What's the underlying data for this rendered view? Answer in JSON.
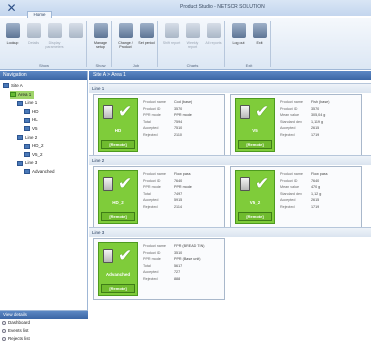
{
  "window": {
    "title": "Product Studio - NETSCR SOLUTION"
  },
  "ribbon": {
    "tab": "Home",
    "groups": [
      {
        "label": "Show",
        "buttons": [
          {
            "label": "Lookup",
            "dim": false
          },
          {
            "label": "Details",
            "dim": true
          },
          {
            "label": "Display parameters",
            "dim": true
          },
          {
            "label": "",
            "dim": true
          }
        ]
      },
      {
        "label": "Show",
        "buttons": [
          {
            "label": "Manage setup",
            "dim": false
          }
        ]
      },
      {
        "label": "Job",
        "buttons": [
          {
            "label": "Change / Product",
            "dim": false
          },
          {
            "label": "Set period",
            "dim": false
          }
        ]
      },
      {
        "label": "Charts",
        "buttons": [
          {
            "label": "Shift report",
            "dim": true
          },
          {
            "label": "Weekly report",
            "dim": true
          },
          {
            "label": "All reports",
            "dim": true
          }
        ]
      },
      {
        "label": "Exit",
        "buttons": [
          {
            "label": "Log out",
            "dim": false
          },
          {
            "label": "Exit",
            "dim": false
          }
        ]
      }
    ]
  },
  "navigation": {
    "header": "Navigation",
    "tree": [
      {
        "label": "Site A",
        "level": 0,
        "ok": false
      },
      {
        "label": "Area 1",
        "level": 1,
        "ok": true,
        "selected": true
      },
      {
        "label": "Line 1",
        "level": 2,
        "ok": false
      },
      {
        "label": "HD",
        "level": 3,
        "ok": false
      },
      {
        "label": "HL",
        "level": 3,
        "ok": false
      },
      {
        "label": "V5",
        "level": 3,
        "ok": false
      },
      {
        "label": "Line 2",
        "level": 2,
        "ok": false
      },
      {
        "label": "HD_2",
        "level": 3,
        "ok": false
      },
      {
        "label": "V5_2",
        "level": 3,
        "ok": false
      },
      {
        "label": "Line 3",
        "level": 2,
        "ok": false
      },
      {
        "label": "Advanched",
        "level": 3,
        "ok": false
      }
    ]
  },
  "view_details": {
    "header": "View details",
    "options": [
      "Dashboard",
      "Events list",
      "Rejects list"
    ]
  },
  "main": {
    "breadcrumb": "Site A > Area 1",
    "remote_label": "[Remote]",
    "lines": [
      {
        "name": "Line 1",
        "tiles": [
          {
            "name": "HD",
            "info": [
              [
                "Product name",
                "Cod (base)"
              ],
              [
                "Product ID",
                "3570"
              ],
              [
                "PPR mode",
                "PPR mode"
              ],
              [
                "Total",
                "7594"
              ],
              [
                "Accepted",
                "7510"
              ],
              [
                "Rejected",
                "2110"
              ]
            ]
          },
          {
            "name": "V5",
            "info": [
              [
                "Product name",
                "Fish (base)"
              ],
              [
                "Product ID",
                "3570"
              ],
              [
                "Mean value",
                "305,04 g"
              ],
              [
                "Standard dev",
                "1,119 g"
              ],
              [
                "Accepted",
                "2615"
              ],
              [
                "Rejected",
                "1719"
              ]
            ]
          }
        ]
      },
      {
        "name": "Line 2",
        "tiles": [
          {
            "name": "HD_2",
            "info": [
              [
                "Product name",
                "Flow pass"
              ],
              [
                "Product ID",
                "7640"
              ],
              [
                "PPR mode",
                "PPR mode"
              ],
              [
                "Total",
                "7497"
              ],
              [
                "Accepted",
                "5915"
              ],
              [
                "Rejected",
                "2114"
              ]
            ]
          },
          {
            "name": "V5_2",
            "info": [
              [
                "Product name",
                "Flow pass"
              ],
              [
                "Product ID",
                "7640"
              ],
              [
                "Mean value",
                "470 g"
              ],
              [
                "Standard dev",
                "1,12 g"
              ],
              [
                "Accepted",
                "2615"
              ],
              [
                "Rejected",
                "1719"
              ]
            ]
          }
        ]
      },
      {
        "name": "Line 3",
        "tiles": [
          {
            "name": "Advanched",
            "info": [
              [
                "Product name",
                "FPR (BREAD TIN)"
              ],
              [
                "Product ID",
                "3510"
              ],
              [
                "PPR mode",
                "PPR (Base unit)"
              ],
              [
                "Total",
                "5617"
              ],
              [
                "Accepted",
                "727"
              ],
              [
                "Rejected",
                "888"
              ]
            ]
          }
        ]
      }
    ]
  }
}
